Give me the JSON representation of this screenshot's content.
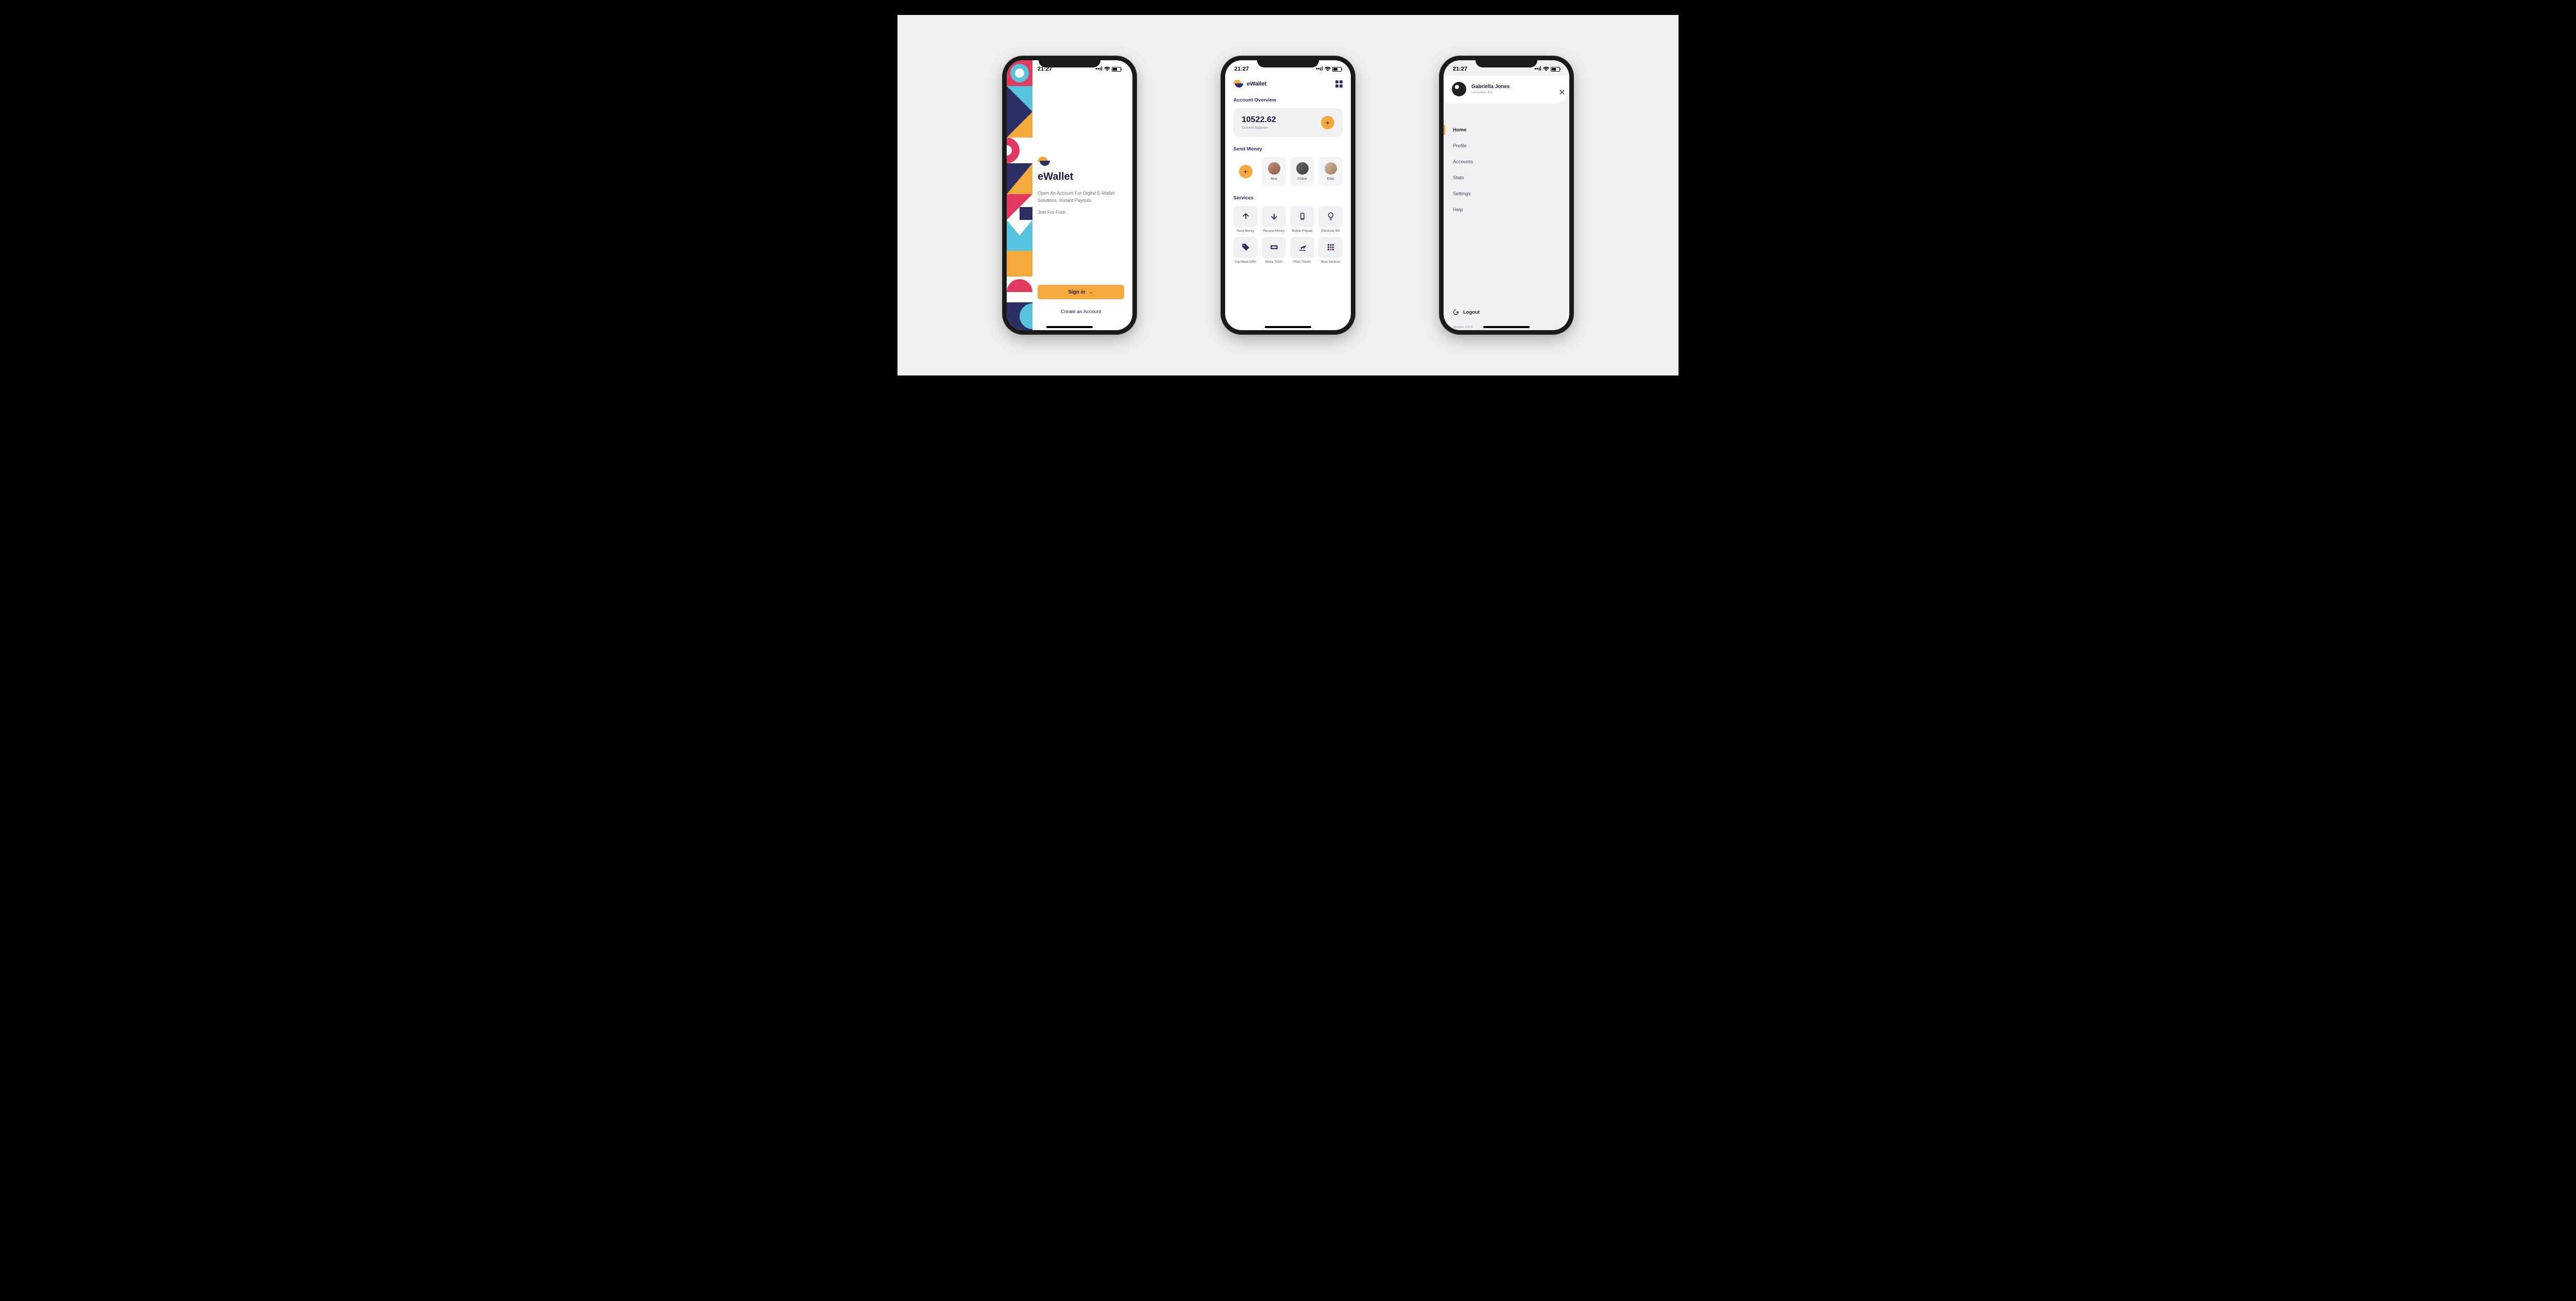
{
  "status": {
    "time": "21:27"
  },
  "landing": {
    "title": "eWallet",
    "tagline": "Open An Account For Digital E-Wallet Solutions. Instant Payouts.",
    "tagline2": "Join For Free.",
    "signin_label": "Sign in",
    "create_label": "Create an Account"
  },
  "home": {
    "brand": "eWallet",
    "overview_title": "Account Overview",
    "balance": "10522.62",
    "balance_label": "Current Balance",
    "send_title": "Send Money",
    "contacts": [
      {
        "name": "Ana"
      },
      {
        "name": "Vickie"
      },
      {
        "name": "Ettie"
      }
    ],
    "services_title": "Services",
    "services": [
      {
        "label": "Send Money"
      },
      {
        "label": "Receive Money"
      },
      {
        "label": "Mobile Prepaid"
      },
      {
        "label": "Electricity Bill"
      },
      {
        "label": "Cashback Offer"
      },
      {
        "label": "Movie Ticket"
      },
      {
        "label": "Flickt Tickets"
      },
      {
        "label": "More Services"
      }
    ]
  },
  "drawer": {
    "profile_name": "Gabriella Jones",
    "profile_location": "Louisiana, AO",
    "menu": [
      {
        "label": "Home",
        "active": true
      },
      {
        "label": "Profile"
      },
      {
        "label": "Accounts"
      },
      {
        "label": "Stats"
      },
      {
        "label": "Settings"
      },
      {
        "label": "Help"
      }
    ],
    "logout": "Logout",
    "version": "Version 1.0.0"
  }
}
